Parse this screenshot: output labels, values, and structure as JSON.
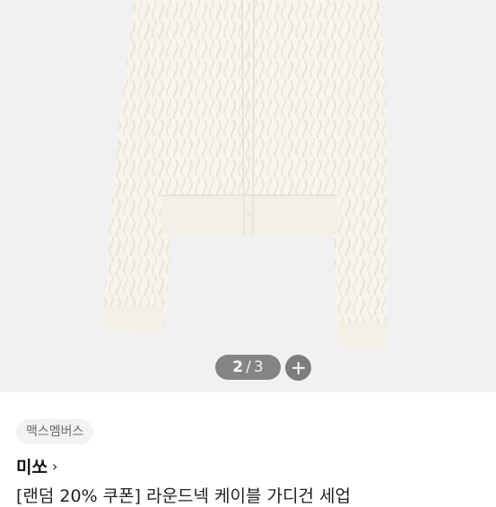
{
  "gallery": {
    "current": "2",
    "separator": "/",
    "total": "3",
    "image_desc_icon": "cardigan-product-image",
    "zoom_icon": "plus-icon"
  },
  "product": {
    "badge": "맥스멤버스",
    "brand": "미쏘",
    "brand_chevron": "›",
    "title": "[랜덤 20% 쿠폰] 라운드넥 케이블 가디건 세업"
  },
  "colors": {
    "hero_bg": "#f1f1f3",
    "garment": "#f7f4ec",
    "counter_bg": "#5a5a5a"
  }
}
